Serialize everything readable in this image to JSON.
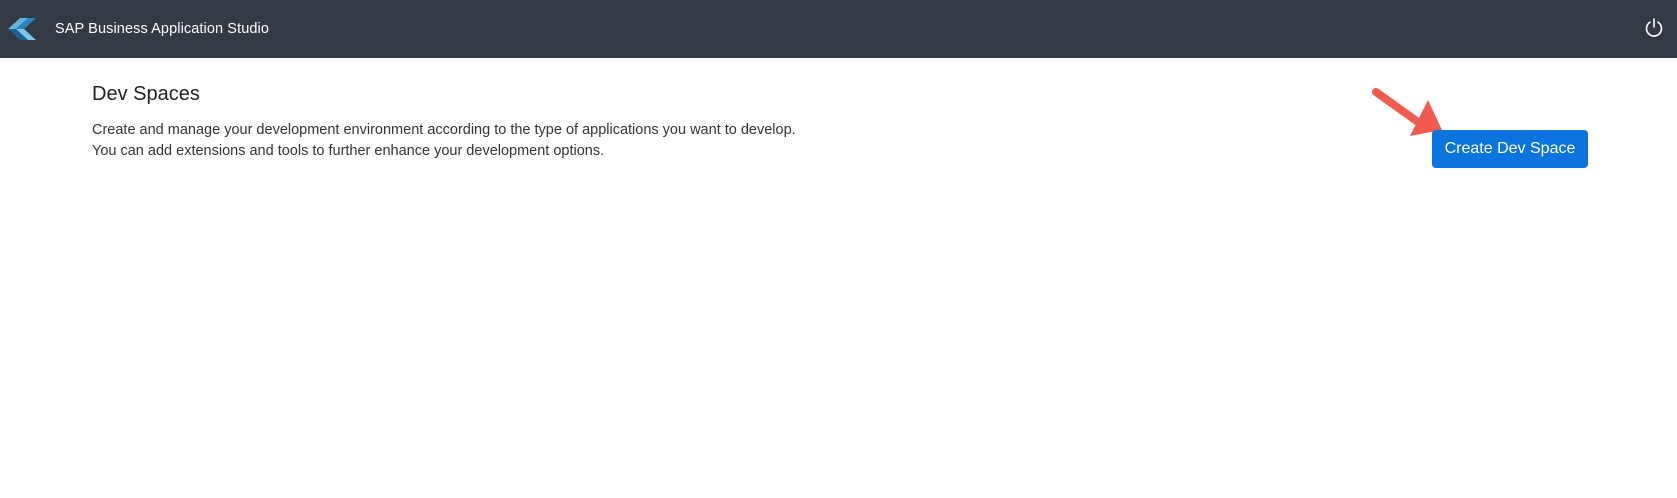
{
  "header": {
    "app_title": "SAP Business Application Studio",
    "logo_icon": "sap-bas-logo-icon",
    "power_icon": "power-icon"
  },
  "main": {
    "title": "Dev Spaces",
    "description_line1": "Create and manage your development environment according to the type of applications you want to develop.",
    "description_line2": "You can add extensions and tools to further enhance your development options.",
    "create_button_label": "Create Dev Space"
  },
  "annotation": {
    "arrow_icon": "red-arrow-icon",
    "arrow_color": "#f05a4f"
  },
  "colors": {
    "topbar": "#343a43",
    "button": "#0b74de"
  }
}
